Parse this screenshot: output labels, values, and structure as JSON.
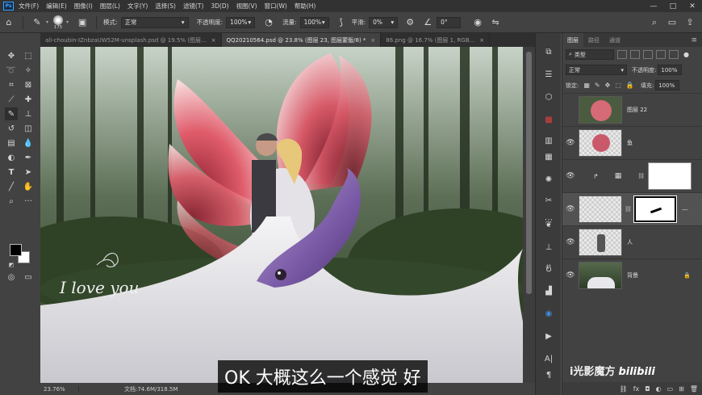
{
  "menubar": {
    "logo": "Ps",
    "items": [
      "文件(F)",
      "编辑(E)",
      "图像(I)",
      "图层(L)",
      "文字(Y)",
      "选择(S)",
      "滤镜(T)",
      "3D(D)",
      "视图(V)",
      "窗口(W)",
      "帮助(H)"
    ],
    "win_min": "—",
    "win_max": "□",
    "win_close": "✕"
  },
  "options": {
    "brush_size": "175",
    "mode_label": "模式:",
    "mode_value": "正常",
    "opacity_label": "不透明度:",
    "opacity_value": "100%",
    "flow_label": "流量:",
    "flow_value": "100%",
    "smooth_label": "平滑:",
    "smooth_value": "0%",
    "angle_value": "0°"
  },
  "tabs": [
    {
      "label": "ali-choubin-IZnbzaUW52M-unsplash.psd @ 19.5% (图层...",
      "active": false
    },
    {
      "label": "QQ20210564.psd @ 23.8% (图层 23, 图层蒙版/8) *",
      "active": true
    },
    {
      "label": "86.png @ 16.7% (图层 1, RGB...",
      "active": false
    }
  ],
  "canvas": {
    "signature_text": "I love you"
  },
  "status": {
    "zoom": "23.76%",
    "doc": "文档:74.6M/318.5M"
  },
  "subtitle": "OK 大概这么一个感觉 好",
  "layers_panel": {
    "tabs": [
      "图层",
      "路径",
      "通道"
    ],
    "filter_label": "类型",
    "blend_mode": "正常",
    "opacity_label": "不透明度:",
    "opacity_value": "100%",
    "lock_label": "锁定:",
    "fill_label": "填充:",
    "fill_value": "100%",
    "layers": [
      {
        "name": "图层 22"
      },
      {
        "name": "鱼"
      },
      {
        "name": ""
      },
      {
        "name": ""
      },
      {
        "name": "人"
      },
      {
        "name": "背景"
      }
    ]
  },
  "watermark": {
    "text": "i光影魔方",
    "logo": "bilibili"
  }
}
